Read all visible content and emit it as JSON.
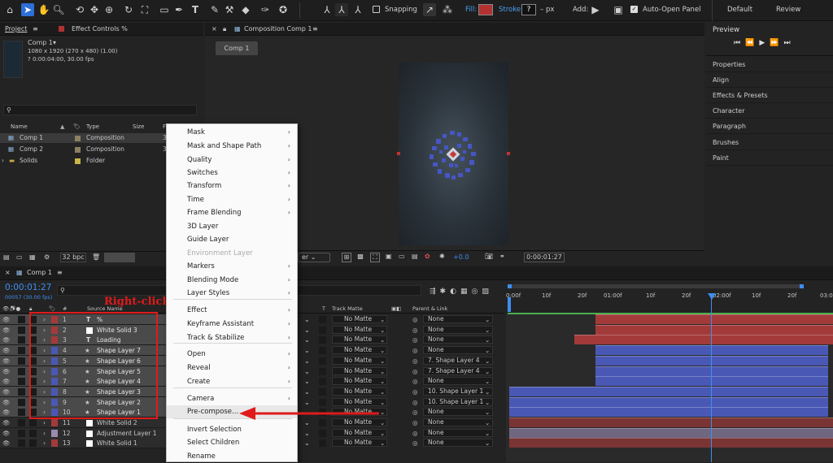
{
  "toolbar": {
    "snapping": "Snapping",
    "fill": "Fill:",
    "stroke": "Stroke:",
    "stroke_value": "?",
    "stroke_unit": "– px",
    "add": "Add:",
    "auto_open": "Auto-Open Panel",
    "workspace_default": "Default",
    "workspace_review": "Review"
  },
  "project": {
    "tab_project": "Project",
    "tab_effects": "Effect Controls %",
    "comp_name": "Comp 1▾",
    "comp_info1": "1080 x 1920  (270 x 480) (1.00)",
    "comp_info2": "? 0:00:04:00, 30.00 fps",
    "col_name": "Name",
    "col_type": "Type",
    "col_size": "Size",
    "col_f": "F",
    "items": [
      {
        "name": "Comp 1",
        "type": "Composition",
        "size": "3"
      },
      {
        "name": "Comp 2",
        "type": "Composition",
        "size": "3"
      },
      {
        "name": "Solids",
        "type": "Folder",
        "size": ""
      }
    ],
    "bpc": "32 bpc"
  },
  "viewer": {
    "tab": "Composition Comp 1",
    "comp_btn": "Comp 1",
    "zoom_fragment": "er",
    "exposure": "+0.0",
    "timecode": "0:00:01:27"
  },
  "right_panel": {
    "preview": "Preview",
    "items": [
      "Properties",
      "Align",
      "Effects & Presets",
      "Character",
      "Paragraph",
      "Brushes",
      "Paint"
    ]
  },
  "timeline": {
    "tab": "Comp 1",
    "timecode": "0:00:01:27",
    "frame_info": "00057 (30.00 fps)",
    "annotation": "Right-click",
    "col_hash": "#",
    "col_source": "Source Name",
    "col_t": "T",
    "col_trackmatte": "Track Matte",
    "col_parent": "Parent & Link",
    "ruler": [
      "0:00f",
      "10f",
      "20f",
      "01:00f",
      "10f",
      "20f",
      "02:00f",
      "10f",
      "20f",
      "03:0"
    ],
    "layers": [
      {
        "num": "1",
        "name": "%",
        "icon": "T",
        "color": "#a33a3a",
        "matte": "No Matte",
        "parent": "None"
      },
      {
        "num": "2",
        "name": "White Solid 3",
        "icon": "□",
        "color": "#a33a3a",
        "matte": "No Matte",
        "parent": "None"
      },
      {
        "num": "3",
        "name": "Loading",
        "icon": "T",
        "color": "#a33a3a",
        "matte": "No Matte",
        "parent": "None"
      },
      {
        "num": "4",
        "name": "Shape Layer 7",
        "icon": "★",
        "color": "#4a58b5",
        "matte": "No Matte",
        "parent": "None"
      },
      {
        "num": "5",
        "name": "Shape Layer 6",
        "icon": "★",
        "color": "#4a58b5",
        "matte": "No Matte",
        "parent": "7. Shape Layer 4"
      },
      {
        "num": "6",
        "name": "Shape Layer 5",
        "icon": "★",
        "color": "#4a58b5",
        "matte": "No Matte",
        "parent": "7. Shape Layer 4"
      },
      {
        "num": "7",
        "name": "Shape Layer 4",
        "icon": "★",
        "color": "#4a58b5",
        "matte": "No Matte",
        "parent": "None"
      },
      {
        "num": "8",
        "name": "Shape Layer 3",
        "icon": "★",
        "color": "#4a58b5",
        "matte": "No Matte",
        "parent": "10. Shape Layer 1"
      },
      {
        "num": "9",
        "name": "Shape Layer 2",
        "icon": "★",
        "color": "#4a58b5",
        "matte": "No Matte",
        "parent": "10. Shape Layer 1"
      },
      {
        "num": "10",
        "name": "Shape Layer 1",
        "icon": "★",
        "color": "#4a58b5",
        "matte": "No Matte",
        "parent": "None"
      },
      {
        "num": "11",
        "name": "White Solid 2",
        "icon": "□",
        "color": "#a33a3a",
        "matte": "No Matte",
        "parent": "None"
      },
      {
        "num": "12",
        "name": "Adjustment Layer 1",
        "icon": "□",
        "color": "#9a8ab0",
        "matte": "No Matte",
        "parent": "None"
      },
      {
        "num": "13",
        "name": "White Solid 1",
        "icon": "□",
        "color": "#a33a3a",
        "matte": "No Matte",
        "parent": "None"
      }
    ]
  },
  "context_menu": {
    "items": [
      {
        "label": "Mask",
        "sub": true
      },
      {
        "label": "Mask and Shape Path",
        "sub": true
      },
      {
        "label": "Quality",
        "sub": true
      },
      {
        "label": "Switches",
        "sub": true
      },
      {
        "label": "Transform",
        "sub": true
      },
      {
        "label": "Time",
        "sub": true
      },
      {
        "label": "Frame Blending",
        "sub": true
      },
      {
        "label": "3D Layer",
        "sub": false
      },
      {
        "label": "Guide Layer",
        "sub": false
      },
      {
        "label": "Environment Layer",
        "sub": false,
        "disabled": true
      },
      {
        "label": "Markers",
        "sub": true
      },
      {
        "label": "Blending Mode",
        "sub": true
      },
      {
        "label": "Layer Styles",
        "sub": true
      },
      {
        "label": "Effect",
        "sub": true
      },
      {
        "label": "Keyframe Assistant",
        "sub": true
      },
      {
        "label": "Track & Stabilize",
        "sub": true
      },
      {
        "label": "Open",
        "sub": true
      },
      {
        "label": "Reveal",
        "sub": true
      },
      {
        "label": "Create",
        "sub": true
      },
      {
        "label": "Camera",
        "sub": true
      },
      {
        "label": "Pre-compose...",
        "sub": false,
        "highlight": true
      },
      {
        "label": "Invert Selection",
        "sub": false
      },
      {
        "label": "Select Children",
        "sub": false
      },
      {
        "label": "Rename",
        "sub": false
      }
    ]
  },
  "colors": {
    "accent": "#2d8ceb",
    "annotation_red": "#e01b1b",
    "shape_blue": "#4a58b5",
    "solid_red": "#a33a3a"
  }
}
